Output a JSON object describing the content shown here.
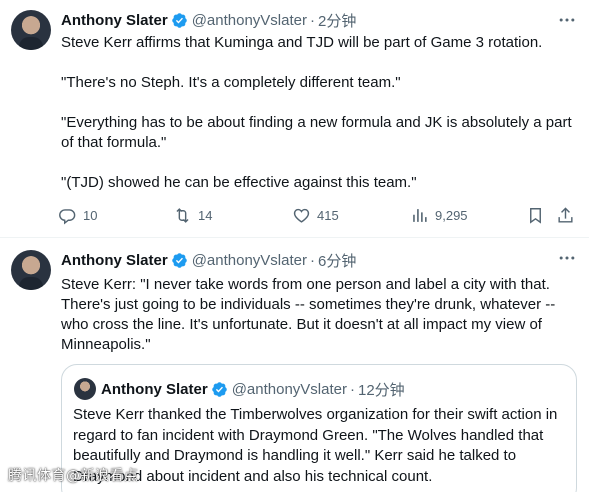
{
  "colors": {
    "verified": "#1d9bf0",
    "muted": "#536471",
    "text": "#0f1419",
    "border": "#cfd9de"
  },
  "tweets": [
    {
      "name": "Anthony Slater",
      "handle": "@anthonyVslater",
      "separator": "·",
      "time": "2分钟",
      "paragraphs": [
        "Steve Kerr affirms that Kuminga and TJD will be part of Game 3 rotation.",
        "\"There's no Steph. It's a completely different team.\"",
        "\"Everything has to be about finding a new formula and JK is absolutely a part of that formula.\"",
        "\"(TJD) showed he can be effective against this team.\""
      ],
      "actions": {
        "replies": "10",
        "retweets": "14",
        "likes": "415",
        "views": "9,295"
      }
    },
    {
      "name": "Anthony Slater",
      "handle": "@anthonyVslater",
      "separator": "·",
      "time": "6分钟",
      "paragraphs": [
        "Steve Kerr: \"I never take words from one person and label a city with that. There's just going to be individuals -- sometimes they're drunk, whatever -- who cross the line. It's unfortunate. But it doesn't at all impact my view of Minneapolis.\""
      ],
      "quote": {
        "name": "Anthony Slater",
        "handle": "@anthonyVslater",
        "separator": "·",
        "time": "12分钟",
        "text": "Steve Kerr thanked the Timberwolves organization for their swift action in regard to fan incident with Draymond Green. \"The Wolves handled that beautifully and Draymond is handling it well.\" Kerr said he talked to Draymond about incident and also his technical count."
      }
    }
  ],
  "watermark": "腾讯体育@新浪看点"
}
